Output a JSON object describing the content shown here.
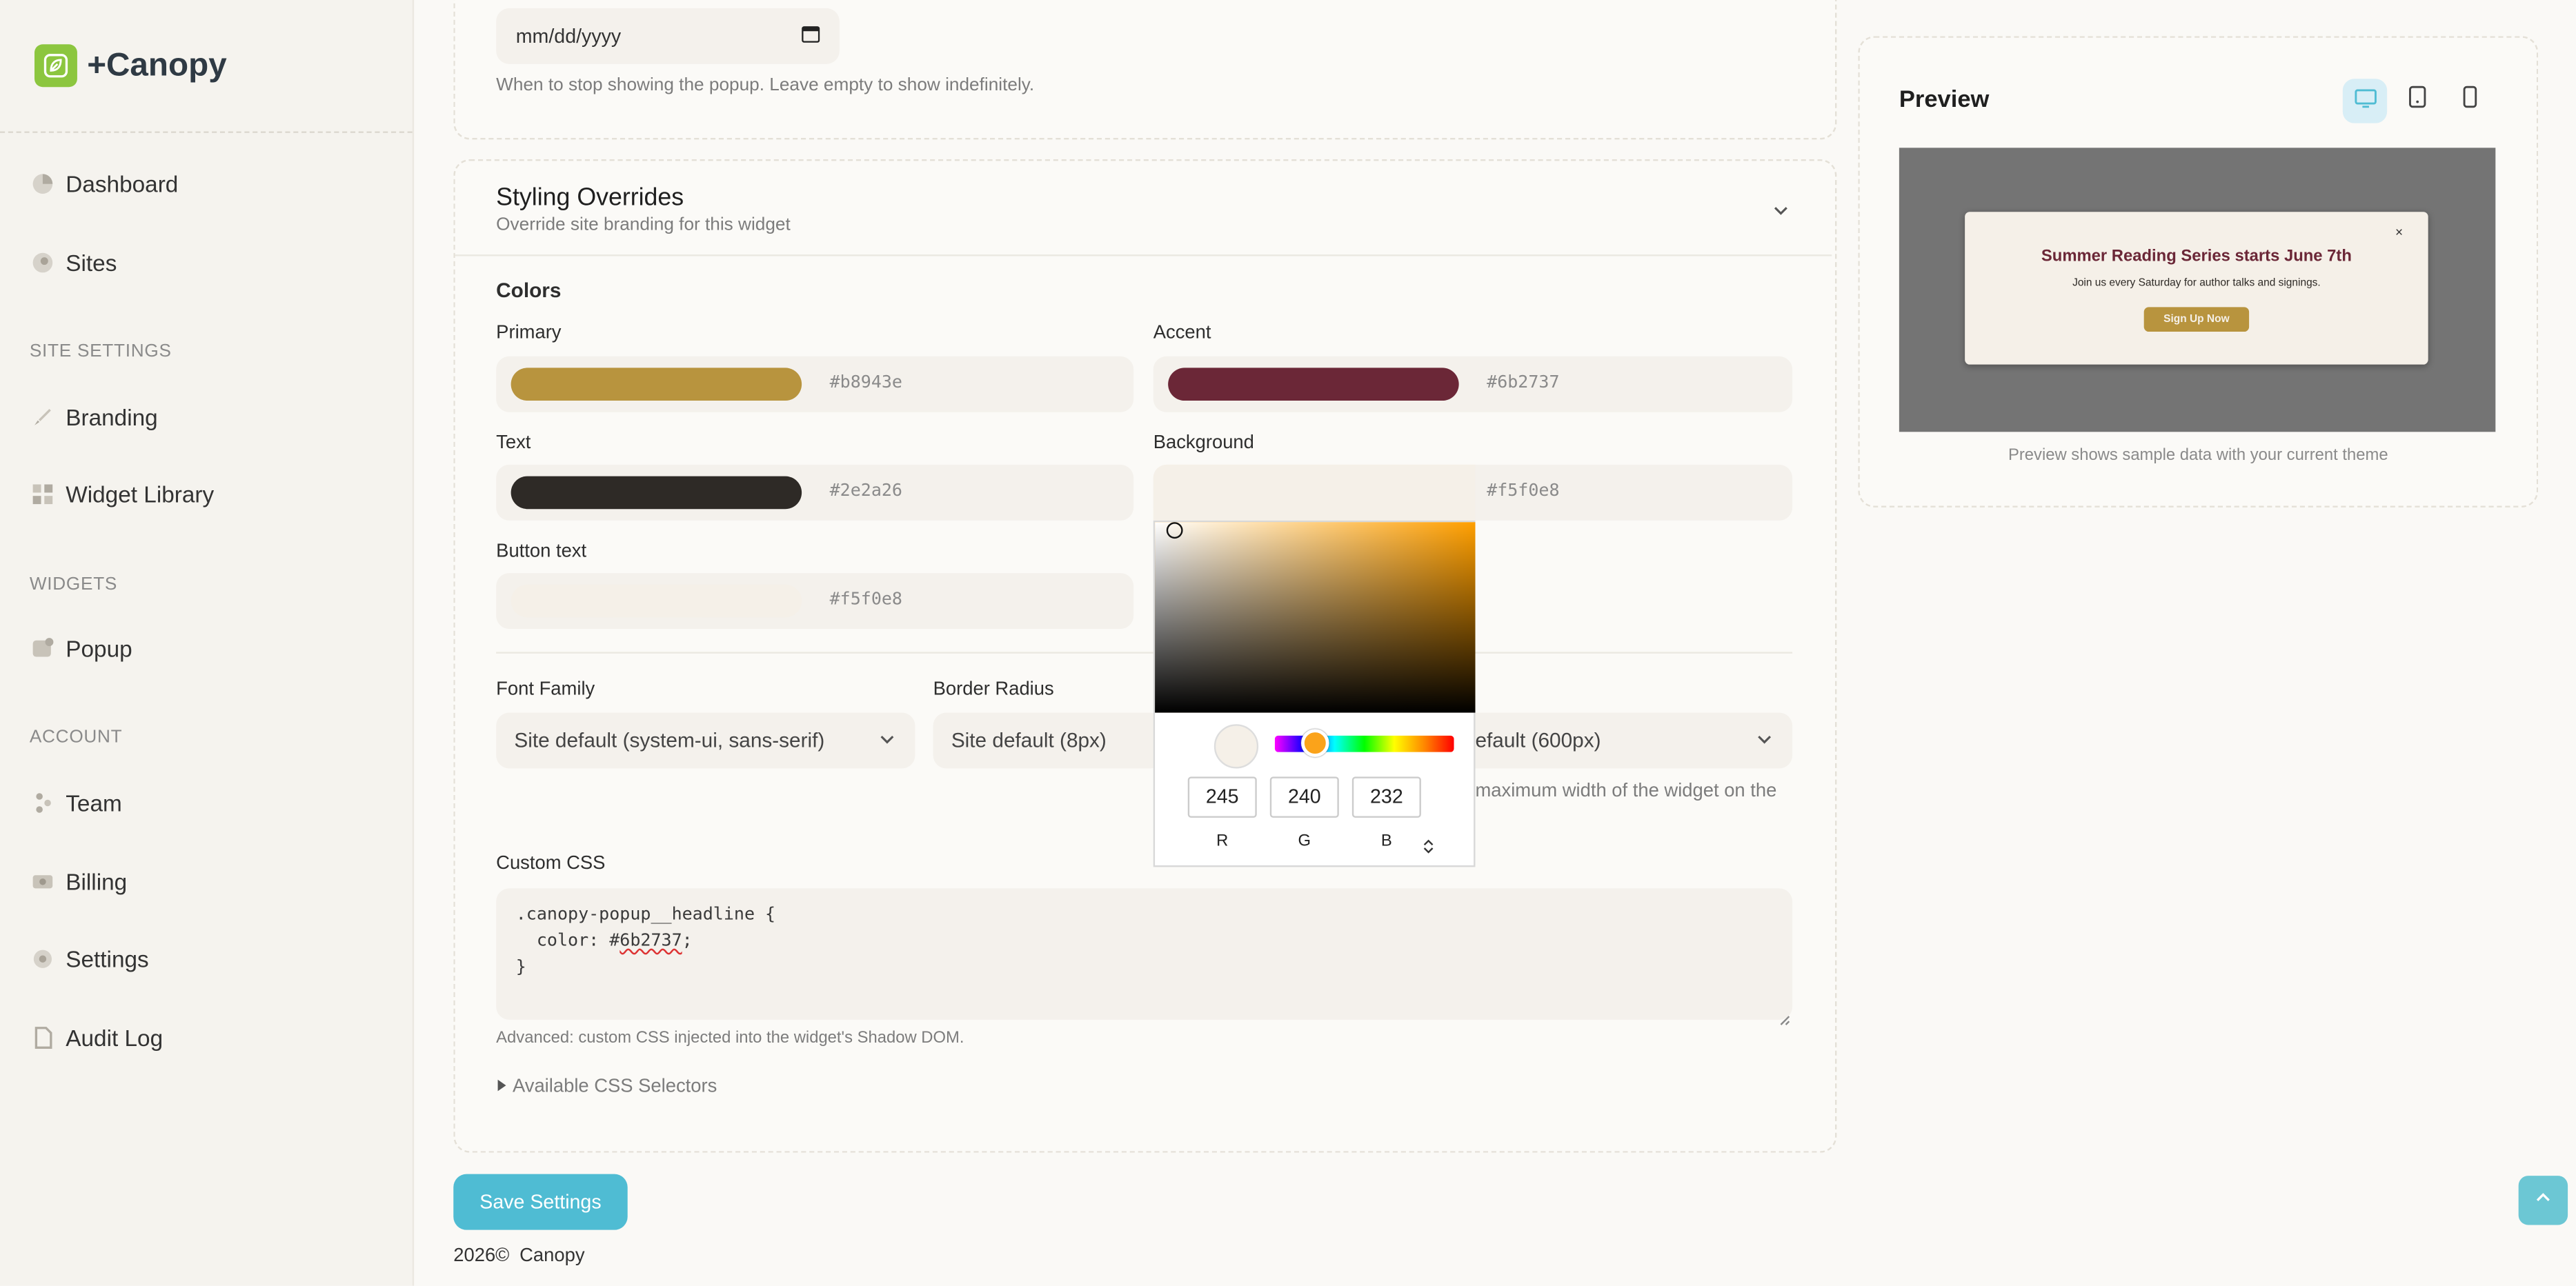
{
  "brand": {
    "name": "+Canopy"
  },
  "sidebar": {
    "items": [
      {
        "label": "Dashboard",
        "icon": "pie-chart-icon"
      },
      {
        "label": "Sites",
        "icon": "globe-icon"
      }
    ],
    "sections": [
      {
        "title": "SITE SETTINGS",
        "items": [
          {
            "label": "Branding",
            "icon": "brush-icon"
          },
          {
            "label": "Widget Library",
            "icon": "grid-icon"
          }
        ]
      },
      {
        "title": "WIDGETS",
        "items": [
          {
            "label": "Popup",
            "icon": "popup-icon"
          }
        ]
      },
      {
        "title": "ACCOUNT",
        "items": [
          {
            "label": "Team",
            "icon": "team-icon"
          },
          {
            "label": "Billing",
            "icon": "card-icon"
          },
          {
            "label": "Settings",
            "icon": "gear-icon"
          },
          {
            "label": "Audit Log",
            "icon": "log-icon"
          }
        ]
      }
    ]
  },
  "schedule": {
    "end_date_placeholder": "mm/dd/yyyy",
    "end_date_help": "When to stop showing the popup. Leave empty to show indefinitely."
  },
  "styling": {
    "title": "Styling Overrides",
    "subtitle": "Override site branding for this widget",
    "colors_label": "Colors",
    "colors": {
      "primary": {
        "label": "Primary",
        "value": "#b8943e"
      },
      "accent": {
        "label": "Accent",
        "value": "#6b2737"
      },
      "text": {
        "label": "Text",
        "value": "#2e2a26"
      },
      "background": {
        "label": "Background",
        "value": "#f5f0e8"
      },
      "button_text": {
        "label": "Button text",
        "value": "#f5f0e8"
      }
    },
    "font_family": {
      "label": "Font Family",
      "value": "Site default (system-ui, sans-serif)"
    },
    "border_radius": {
      "label": "Border Radius",
      "value": "Site default (8px)"
    },
    "max_width": {
      "value_partial": "efault (600px)",
      "help_partial": "maximum width of the widget on the"
    },
    "custom_css": {
      "label": "Custom CSS",
      "line1": ".canopy-popup__headline {",
      "line2_prefix": "  color: #",
      "line2_squiggle": "6b2737",
      "line2_suffix": ";",
      "line3": "}",
      "help": "Advanced: custom CSS injected into the widget's Shadow DOM."
    },
    "selectors_toggle": "Available CSS Selectors"
  },
  "color_picker": {
    "r": "245",
    "g": "240",
    "b": "232",
    "r_label": "R",
    "g_label": "G",
    "b_label": "B",
    "hue_color": "#ff9f00"
  },
  "preview": {
    "title": "Preview",
    "popup": {
      "headline": "Summer Reading Series starts June 7th",
      "body": "Join us every Saturday for author talks and signings.",
      "button": "Sign Up Now",
      "close": "×"
    },
    "note": "Preview shows sample data with your current theme"
  },
  "actions": {
    "save_label": "Save Settings"
  },
  "footer": {
    "year": "2026©",
    "company": "Canopy"
  },
  "theme": {
    "accent": "#4fbcd3",
    "sidebar_bg": "#f5f3ee"
  }
}
